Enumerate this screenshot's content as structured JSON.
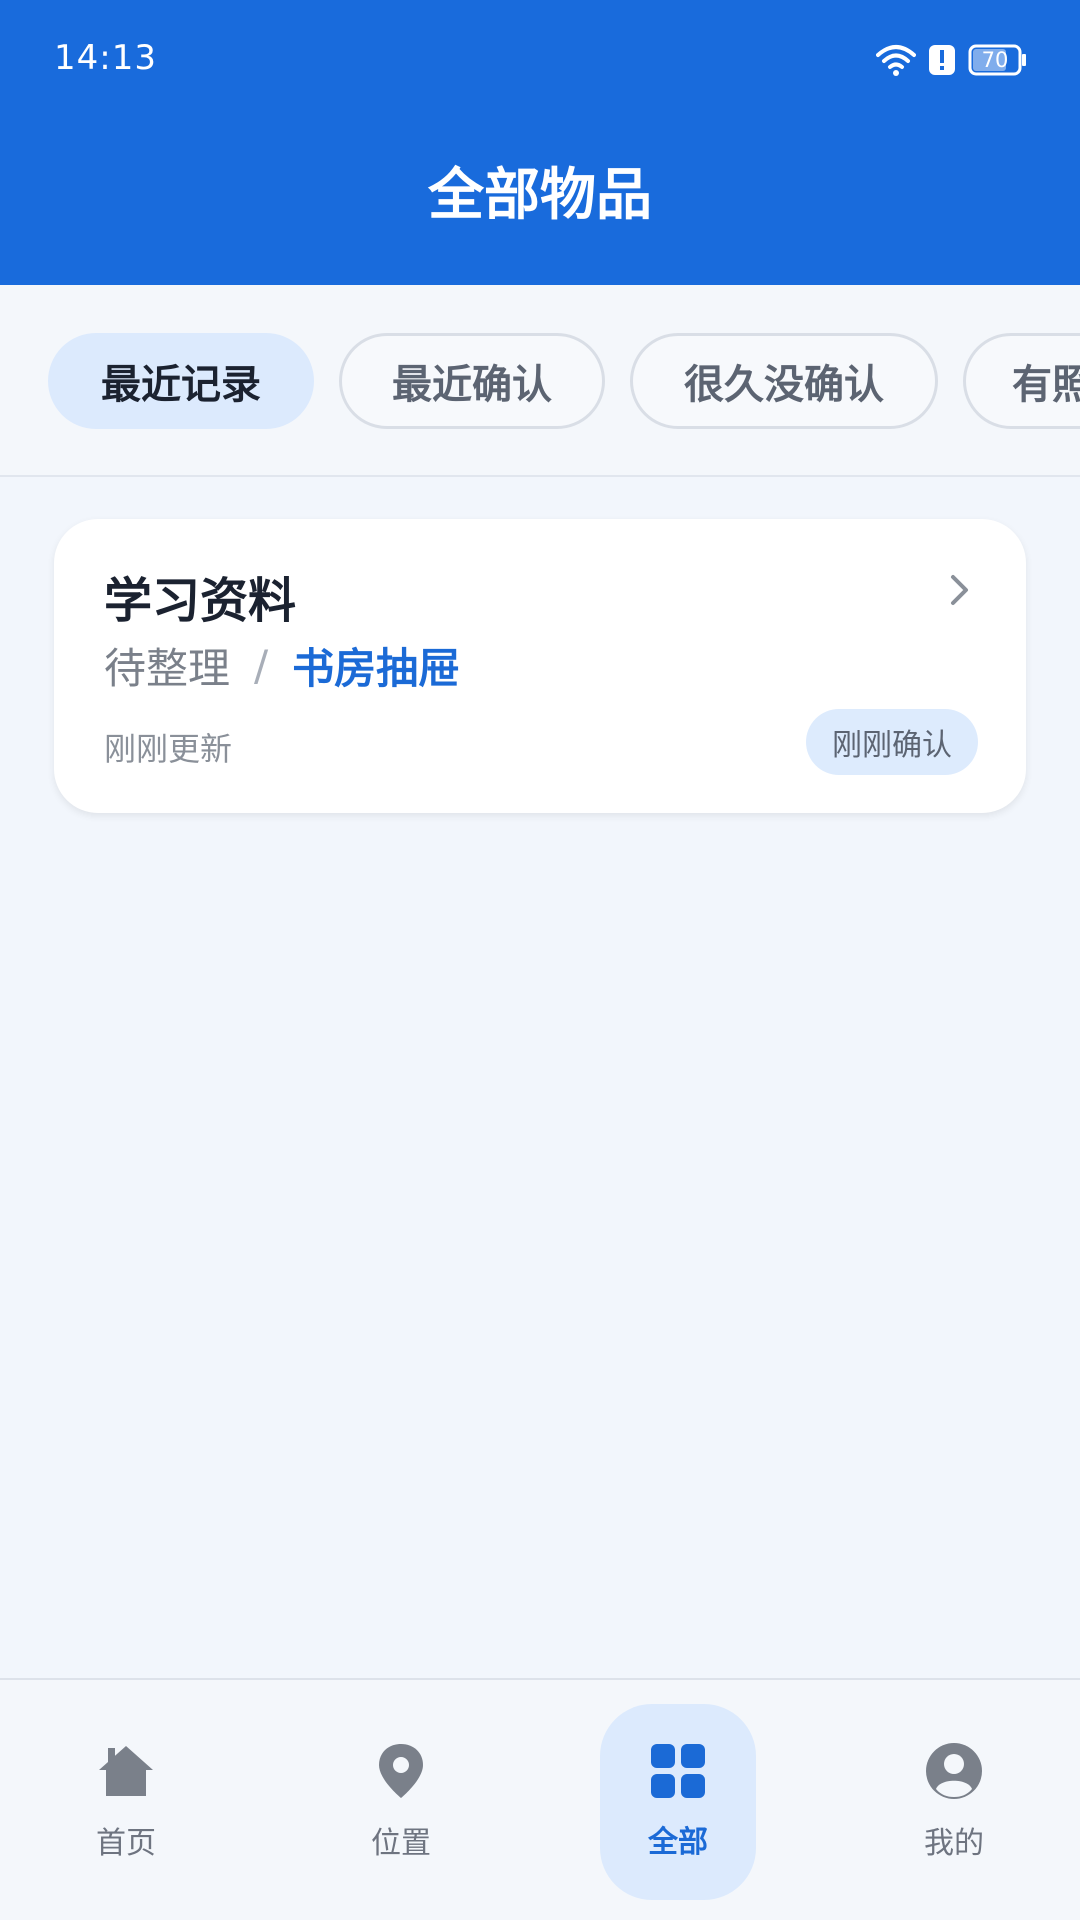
{
  "status_bar": {
    "time": "14:13",
    "battery": "70",
    "icons": [
      "wifi-icon",
      "alert-icon",
      "battery-icon"
    ]
  },
  "header": {
    "title": "全部物品"
  },
  "filters": [
    {
      "label": "最近记录",
      "active": true
    },
    {
      "label": "最近确认",
      "active": false
    },
    {
      "label": "很久没确认",
      "active": false
    },
    {
      "label": "有照",
      "active": false
    }
  ],
  "items": [
    {
      "name": "学习资料",
      "status": "待整理",
      "separator": "/",
      "location": "书房抽屉",
      "updated": "刚刚更新",
      "badge": "刚刚确认"
    }
  ],
  "bottom_nav": [
    {
      "label": "首页",
      "icon": "home-icon",
      "active": false
    },
    {
      "label": "位置",
      "icon": "location-pin-icon",
      "active": false
    },
    {
      "label": "全部",
      "icon": "grid-icon",
      "active": true
    },
    {
      "label": "我的",
      "icon": "profile-icon",
      "active": false
    }
  ],
  "colors": {
    "primary": "#196BDC",
    "background": "#F2F6FC",
    "active_tint": "#DCEAFD"
  }
}
